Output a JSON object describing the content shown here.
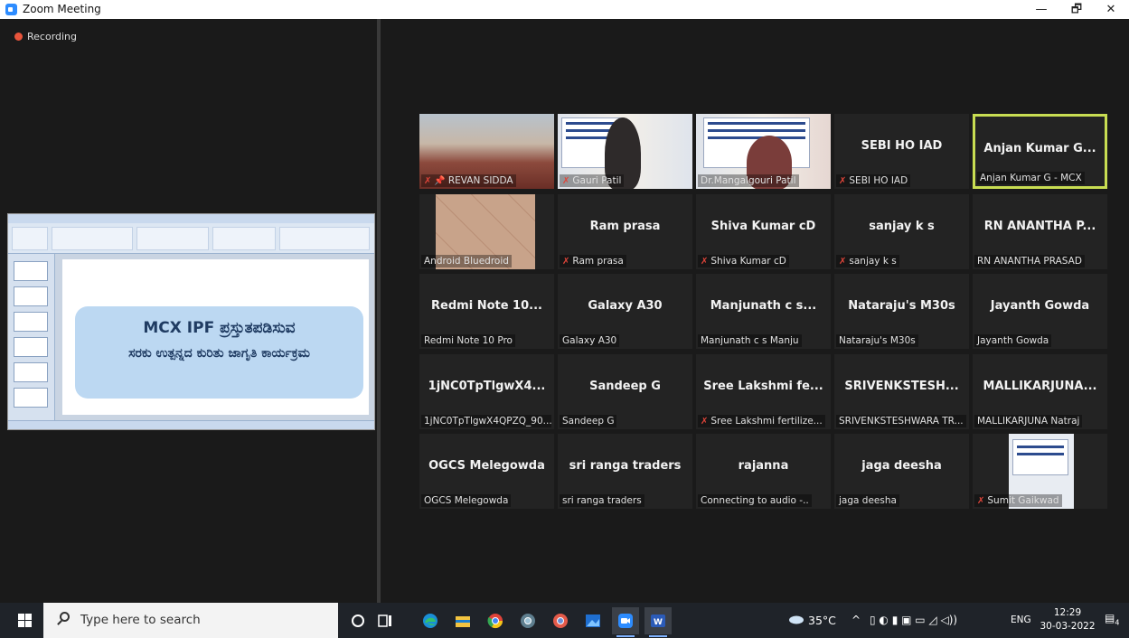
{
  "window": {
    "title": "Zoom Meeting",
    "minimize": "—",
    "restore": "🗗",
    "close": "✕"
  },
  "recording": {
    "label": "Recording"
  },
  "shared_screen": {
    "line1": "MCX IPF ಪ್ರಸ್ತುತಪಡಿಸುವ",
    "line2": "ಸರಕು ಉತ್ಪನ್ನದ ಕುರಿತು ಜಾಗೃತಿ ಕಾರ್ಯಕ್ರಮ"
  },
  "participants": [
    {
      "name": "",
      "label": "REVAN SIDDA",
      "muted": true,
      "pinned": true,
      "video": true
    },
    {
      "name": "",
      "label": "Gauri Patil",
      "muted": true,
      "pinned": false,
      "video": true
    },
    {
      "name": "",
      "label": "Dr.Mangalgouri Patil",
      "muted": false,
      "pinned": false,
      "video": true
    },
    {
      "name": "SEBI HO IAD",
      "label": "SEBI HO IAD",
      "muted": true,
      "pinned": false,
      "video": false
    },
    {
      "name": "Anjan Kumar G...",
      "label": "Anjan Kumar G - MCX",
      "muted": false,
      "pinned": false,
      "video": false,
      "active": true
    },
    {
      "name": "",
      "label": "Android Bluedroid",
      "muted": false,
      "pinned": false,
      "video": true
    },
    {
      "name": "Ram prasa",
      "label": "Ram prasa",
      "muted": true,
      "pinned": false,
      "video": false
    },
    {
      "name": "Shiva Kumar cD",
      "label": "Shiva Kumar cD",
      "muted": true,
      "pinned": false,
      "video": false
    },
    {
      "name": "sanjay k s",
      "label": "sanjay k s",
      "muted": true,
      "pinned": false,
      "video": false
    },
    {
      "name": "RN ANANTHA P...",
      "label": "RN ANANTHA PRASAD",
      "muted": false,
      "pinned": false,
      "video": false
    },
    {
      "name": "Redmi Note 10...",
      "label": "Redmi Note 10 Pro",
      "muted": false,
      "pinned": false,
      "video": false
    },
    {
      "name": "Galaxy A30",
      "label": "Galaxy A30",
      "muted": false,
      "pinned": false,
      "video": false
    },
    {
      "name": "Manjunath c s...",
      "label": "Manjunath c s Manju",
      "muted": false,
      "pinned": false,
      "video": false
    },
    {
      "name": "Nataraju's M30s",
      "label": "Nataraju's M30s",
      "muted": false,
      "pinned": false,
      "video": false
    },
    {
      "name": "Jayanth Gowda",
      "label": "Jayanth Gowda",
      "muted": false,
      "pinned": false,
      "video": false
    },
    {
      "name": "1jNC0TpTlgwX4...",
      "label": "1jNC0TpTlgwX4QPZQ_90...",
      "muted": false,
      "pinned": false,
      "video": false
    },
    {
      "name": "Sandeep G",
      "label": "Sandeep G",
      "muted": false,
      "pinned": false,
      "video": false
    },
    {
      "name": "Sree Lakshmi fe...",
      "label": "Sree Lakshmi fertilize...",
      "muted": true,
      "pinned": false,
      "video": false
    },
    {
      "name": "SRIVENKSTESH...",
      "label": "SRIVENKSTESHWARA TR...",
      "muted": false,
      "pinned": false,
      "video": false
    },
    {
      "name": "MALLIKARJUNA...",
      "label": "MALLIKARJUNA Natraj",
      "muted": false,
      "pinned": false,
      "video": false
    },
    {
      "name": "OGCS Melegowda",
      "label": "OGCS Melegowda",
      "muted": false,
      "pinned": false,
      "video": false
    },
    {
      "name": "sri ranga traders",
      "label": "sri ranga traders",
      "muted": false,
      "pinned": false,
      "video": false
    },
    {
      "name": "rajanna",
      "label": "Connecting to audio -..",
      "muted": false,
      "pinned": false,
      "video": false
    },
    {
      "name": "jaga deesha",
      "label": "jaga deesha",
      "muted": false,
      "pinned": false,
      "video": false
    },
    {
      "name": "",
      "label": "Sumit Gaikwad",
      "muted": true,
      "pinned": false,
      "video": true
    }
  ],
  "taskbar": {
    "search_placeholder": "Type here to search",
    "apps": [
      "cortana-icon",
      "task-view-icon",
      "edge-icon",
      "file-explorer-icon",
      "chrome-icon",
      "chrome-profile-icon",
      "chrome-alt-icon",
      "photos-icon",
      "zoom-icon",
      "word-icon"
    ],
    "weather": "35°C",
    "language": "ENG",
    "time": "12:29",
    "date": "30-03-2022",
    "notification_count": "4"
  }
}
